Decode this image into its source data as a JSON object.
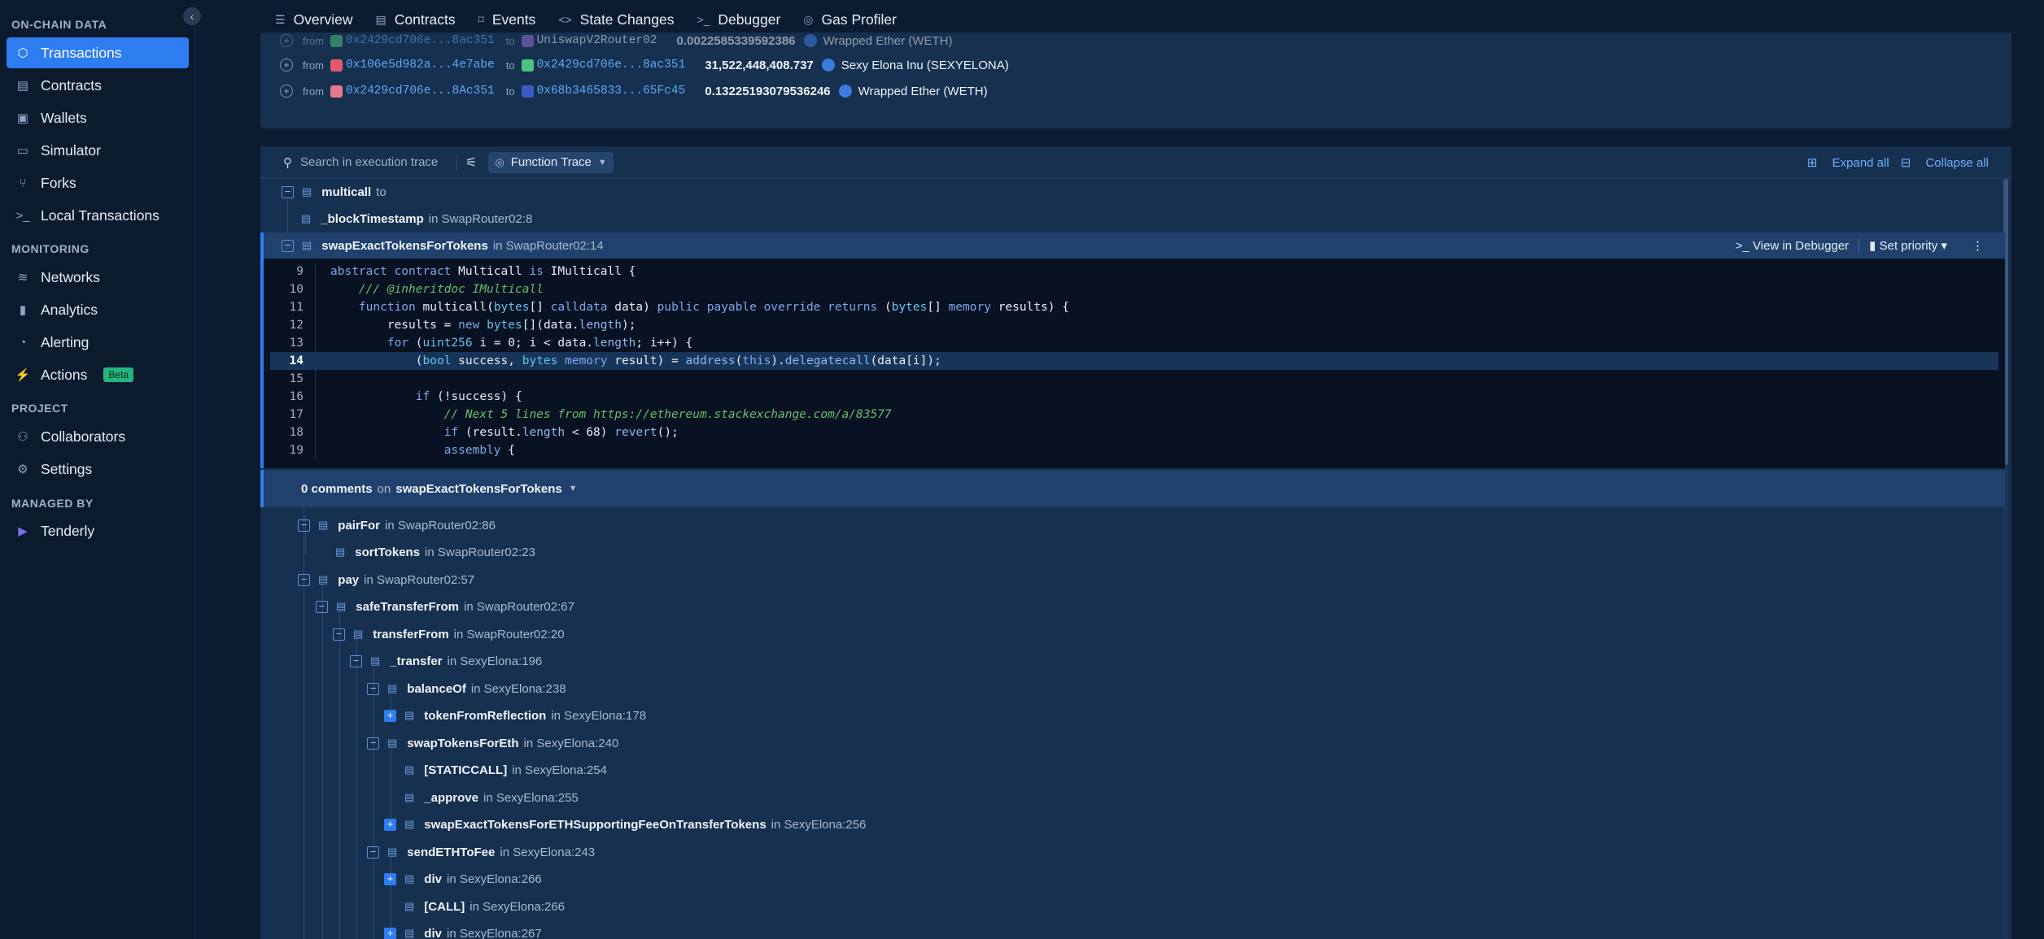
{
  "sidebar": {
    "sections": {
      "onchain": "ON-CHAIN DATA",
      "monitoring": "MONITORING",
      "project": "PROJECT",
      "managed_by": "MANAGED BY"
    },
    "items": {
      "transactions": "Transactions",
      "contracts": "Contracts",
      "wallets": "Wallets",
      "simulator": "Simulator",
      "forks": "Forks",
      "local_transactions": "Local Transactions",
      "networks": "Networks",
      "analytics": "Analytics",
      "alerting": "Alerting",
      "actions": "Actions",
      "actions_badge": "Beta",
      "collaborators": "Collaborators",
      "settings": "Settings",
      "tenderly": "Tenderly"
    }
  },
  "tabs": {
    "overview": "Overview",
    "contracts": "Contracts",
    "events": "Events",
    "state_changes": "State Changes",
    "debugger": "Debugger",
    "gas_profiler": "Gas Profiler"
  },
  "transfers": [
    {
      "from_label": "from",
      "from": "0x2429cd706e...8ac351",
      "to_label": "to",
      "to": "UniswapV2Router02",
      "amount": "0.0022585339592386",
      "token": "Wrapped Ether (WETH)"
    },
    {
      "from_label": "from",
      "from": "0x106e5d982a...4e7abe",
      "to_label": "to",
      "to": "0x2429cd706e...8ac351",
      "amount": "31,522,448,408.737",
      "token": "Sexy Elona Inu (SEXYELONA)"
    },
    {
      "from_label": "from",
      "from": "0x2429cd706e...8Ac351",
      "to_label": "to",
      "to": "0x68b3465833...65Fc45",
      "amount": "0.13225193079536246",
      "token": "Wrapped Ether (WETH)"
    }
  ],
  "trace": {
    "search_placeholder": "Search in execution trace",
    "mode": "Function Trace",
    "expand_all": "Expand all",
    "collapse_all": "Collapse all",
    "view_in_debugger": "View in Debugger",
    "set_priority": "Set priority",
    "nodes": [
      {
        "fn": "multicall",
        "loc": "to"
      },
      {
        "fn": "_blockTimestamp",
        "loc": "in SwapRouter02:8"
      },
      {
        "fn": "swapExactTokensForTokens",
        "loc": "in SwapRouter02:14"
      },
      {
        "fn": "pairFor",
        "loc": "in SwapRouter02:86"
      },
      {
        "fn": "sortTokens",
        "loc": "in SwapRouter02:23"
      },
      {
        "fn": "pay",
        "loc": "in SwapRouter02:57"
      },
      {
        "fn": "safeTransferFrom",
        "loc": "in SwapRouter02:67"
      },
      {
        "fn": "transferFrom",
        "loc": "in SwapRouter02:20"
      },
      {
        "fn": "_transfer",
        "loc": "in SexyElona:196"
      },
      {
        "fn": "balanceOf",
        "loc": "in SexyElona:238"
      },
      {
        "fn": "tokenFromReflection",
        "loc": "in SexyElona:178"
      },
      {
        "fn": "swapTokensForEth",
        "loc": "in SexyElona:240"
      },
      {
        "fn": "[STATICCALL]",
        "loc": "in SexyElona:254"
      },
      {
        "fn": "_approve",
        "loc": "in SexyElona:255"
      },
      {
        "fn": "swapExactTokensForETHSupportingFeeOnTransferTokens",
        "loc": "in SexyElona:256"
      },
      {
        "fn": "sendETHToFee",
        "loc": "in SexyElona:243"
      },
      {
        "fn": "div",
        "loc": "in SexyElona:266"
      },
      {
        "fn": "[CALL]",
        "loc": "in SexyElona:266"
      },
      {
        "fn": "div",
        "loc": "in SexyElona:267"
      }
    ],
    "code_lines": [
      "9",
      "10",
      "11",
      "12",
      "13",
      "14",
      "15",
      "16",
      "17",
      "18",
      "19"
    ],
    "highlight_line": "14",
    "comments_count": "0 comments",
    "comments_on": "on",
    "comments_fn": "swapExactTokensForTokens"
  }
}
